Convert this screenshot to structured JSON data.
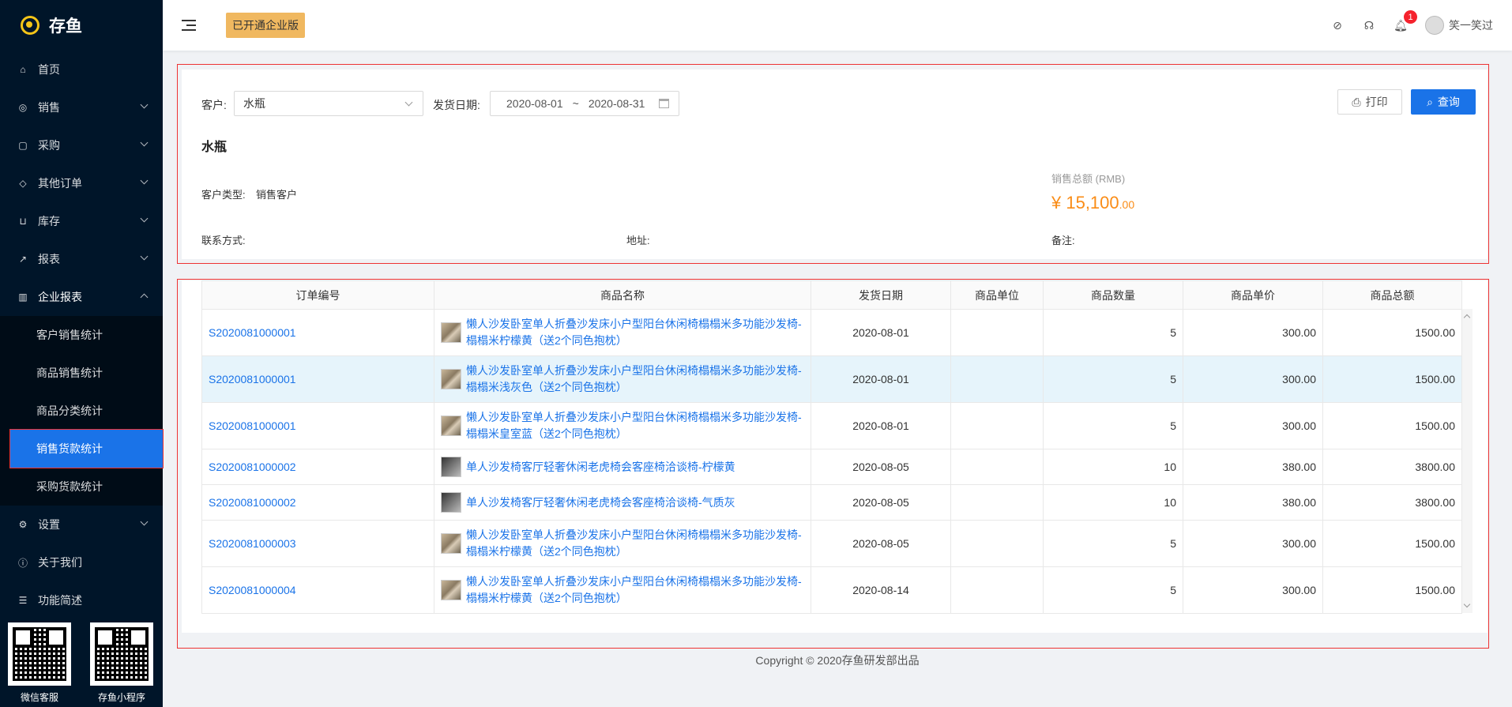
{
  "app": {
    "name": "存鱼"
  },
  "sidebar": {
    "items": [
      {
        "label": "首页",
        "icon": "home-icon"
      },
      {
        "label": "销售",
        "icon": "sales-icon"
      },
      {
        "label": "采购",
        "icon": "bag-icon"
      },
      {
        "label": "其他订单",
        "icon": "tag-icon"
      },
      {
        "label": "库存",
        "icon": "cart-icon"
      },
      {
        "label": "报表",
        "icon": "chart-icon"
      },
      {
        "label": "企业报表",
        "icon": "bar-chart-icon"
      }
    ],
    "subitems": [
      "客户销售统计",
      "商品销售统计",
      "商品分类统计",
      "销售货款统计",
      "采购货款统计"
    ],
    "bottom_items": [
      {
        "label": "设置",
        "icon": "gear-icon"
      },
      {
        "label": "关于我们",
        "icon": "info-icon"
      },
      {
        "label": "功能简述",
        "icon": "list-icon"
      }
    ],
    "qr": [
      "微信客服",
      "存鱼小程序"
    ]
  },
  "header": {
    "badge": "已开通企业版",
    "notification_count": "1",
    "user_name": "笑一笑过"
  },
  "filter": {
    "customer_label": "客户:",
    "customer_value": "水瓶",
    "date_label": "发货日期:",
    "date_start": "2020-08-01",
    "date_sep": "~",
    "date_end": "2020-08-31",
    "print_label": "打印",
    "query_label": "查询"
  },
  "customer": {
    "name": "水瓶",
    "type_label": "客户类型:",
    "type_value": "销售客户",
    "contact_label": "联系方式:",
    "address_label": "地址:",
    "note_label": "备注:",
    "total_label": "销售总额 (RMB)",
    "total_int": "¥ 15,100",
    "total_dec": ".00"
  },
  "table": {
    "columns": [
      "订单编号",
      "商品名称",
      "发货日期",
      "商品单位",
      "商品数量",
      "商品单价",
      "商品总额"
    ],
    "rows": [
      {
        "order": "S2020081000001",
        "product": "懒人沙发卧室单人折叠沙发床小户型阳台休闲椅榻榻米多功能沙发椅-榻榻米柠檬黄（送2个同色抱枕）",
        "date": "2020-08-01",
        "unit": "",
        "qty": "5",
        "price": "300.00",
        "total": "1500.00"
      },
      {
        "order": "S2020081000001",
        "product": "懒人沙发卧室单人折叠沙发床小户型阳台休闲椅榻榻米多功能沙发椅-榻榻米浅灰色（送2个同色抱枕）",
        "date": "2020-08-01",
        "unit": "",
        "qty": "5",
        "price": "300.00",
        "total": "1500.00"
      },
      {
        "order": "S2020081000001",
        "product": "懒人沙发卧室单人折叠沙发床小户型阳台休闲椅榻榻米多功能沙发椅-榻榻米皇室蓝（送2个同色抱枕）",
        "date": "2020-08-01",
        "unit": "",
        "qty": "5",
        "price": "300.00",
        "total": "1500.00"
      },
      {
        "order": "S2020081000002",
        "product": "单人沙发椅客厅轻奢休闲老虎椅会客座椅洽谈椅-柠檬黄",
        "date": "2020-08-05",
        "unit": "",
        "qty": "10",
        "price": "380.00",
        "total": "3800.00"
      },
      {
        "order": "S2020081000002",
        "product": "单人沙发椅客厅轻奢休闲老虎椅会客座椅洽谈椅-气质灰",
        "date": "2020-08-05",
        "unit": "",
        "qty": "10",
        "price": "380.00",
        "total": "3800.00"
      },
      {
        "order": "S2020081000003",
        "product": "懒人沙发卧室单人折叠沙发床小户型阳台休闲椅榻榻米多功能沙发椅-榻榻米柠檬黄（送2个同色抱枕）",
        "date": "2020-08-05",
        "unit": "",
        "qty": "5",
        "price": "300.00",
        "total": "1500.00"
      },
      {
        "order": "S2020081000004",
        "product": "懒人沙发卧室单人折叠沙发床小户型阳台休闲椅榻榻米多功能沙发椅-榻榻米柠檬黄（送2个同色抱枕）",
        "date": "2020-08-14",
        "unit": "",
        "qty": "5",
        "price": "300.00",
        "total": "1500.00"
      }
    ]
  },
  "footer": {
    "text": "Copyright © 2020存鱼研发部出品"
  }
}
